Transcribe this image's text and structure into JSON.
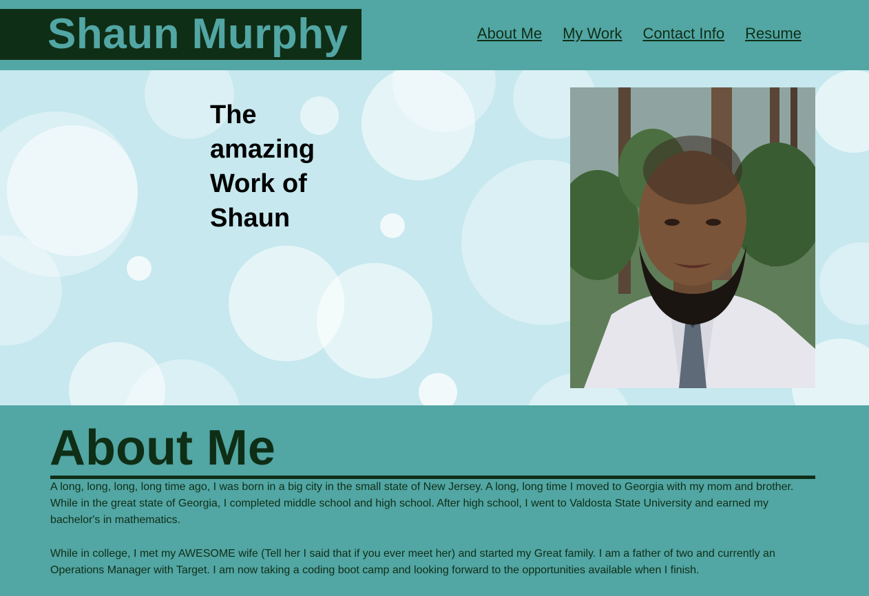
{
  "site": {
    "name": "Shaun Murphy"
  },
  "nav": {
    "items": [
      {
        "label": "About Me"
      },
      {
        "label": "My Work"
      },
      {
        "label": "Contact Info"
      },
      {
        "label": "Resume"
      }
    ]
  },
  "hero": {
    "title": "The amazing Work of Shaun"
  },
  "about": {
    "heading": "About Me",
    "paragraphs": [
      "A long, long, long, long time ago, I was born in a big city in the small state of New Jersey. A long, long time I moved to Georgia with my mom and brother. While in the great state of Georgia, I completed middle school and high school. After high school, I went to Valdosta State University and earned my bachelor's in mathematics.",
      "While in college, I met my AWESOME wife (Tell her I said that if you ever meet her) and started my Great family. I am a father of two and currently an Operations Manager with Target. I am now taking a coding boot camp and looking forward to the opportunities available when I finish."
    ]
  },
  "colors": {
    "header_bg": "#52a6a4",
    "brand_bg": "#0f2e16",
    "dark_green": "#0f2e16",
    "hero_bg": "#c6e8ee"
  }
}
